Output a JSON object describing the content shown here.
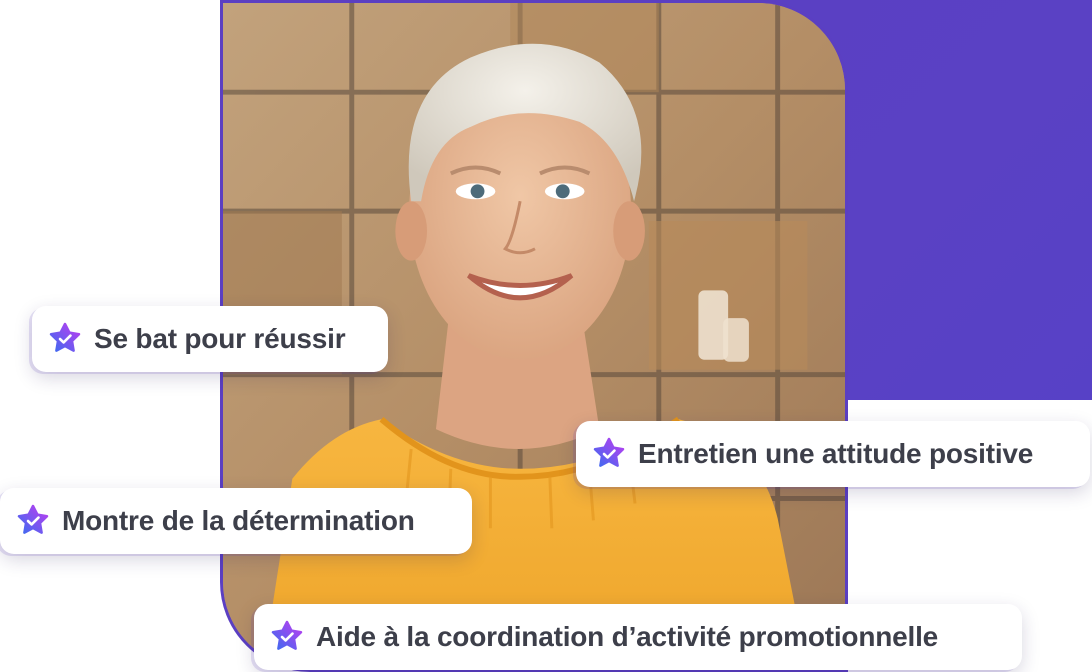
{
  "colors": {
    "accent": "#5b3fc2",
    "badge_text": "#3d3f4a",
    "badge_background": "#ffffff",
    "star_gradient_start": "#3b6cf0",
    "star_gradient_end": "#c03cf0"
  },
  "photo": {
    "icon": "portrait-photo"
  },
  "badges": [
    {
      "icon": "star-check-icon",
      "label": "Se bat pour réussir"
    },
    {
      "icon": "star-check-icon",
      "label": "Entretien une attitude positive"
    },
    {
      "icon": "star-check-icon",
      "label": "Montre de la détermination"
    },
    {
      "icon": "star-check-icon",
      "label": "Aide à la coordination d’activité promotionnelle"
    }
  ]
}
